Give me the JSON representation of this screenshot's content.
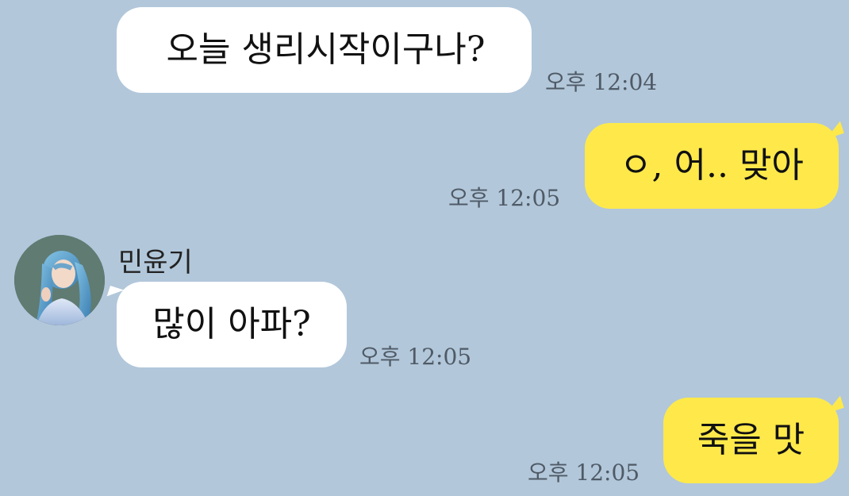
{
  "messages": [
    {
      "direction": "incoming",
      "text": "오늘 생리시작이구나?",
      "time": "오후 12:04"
    },
    {
      "direction": "outgoing",
      "text": "ㅇ, 어.. 맞아",
      "time": "오후 12:05"
    },
    {
      "direction": "incoming",
      "sender": "민윤기",
      "text": "많이 아파?",
      "time": "오후 12:05"
    },
    {
      "direction": "outgoing",
      "text": "죽을 맛",
      "time": "오후 12:05"
    }
  ],
  "colors": {
    "background": "#b2c7da",
    "incoming_bubble": "#ffffff",
    "outgoing_bubble": "#ffe94a",
    "timestamp_text": "#4f5a66"
  },
  "icons": {
    "avatar": "profile-photo"
  }
}
